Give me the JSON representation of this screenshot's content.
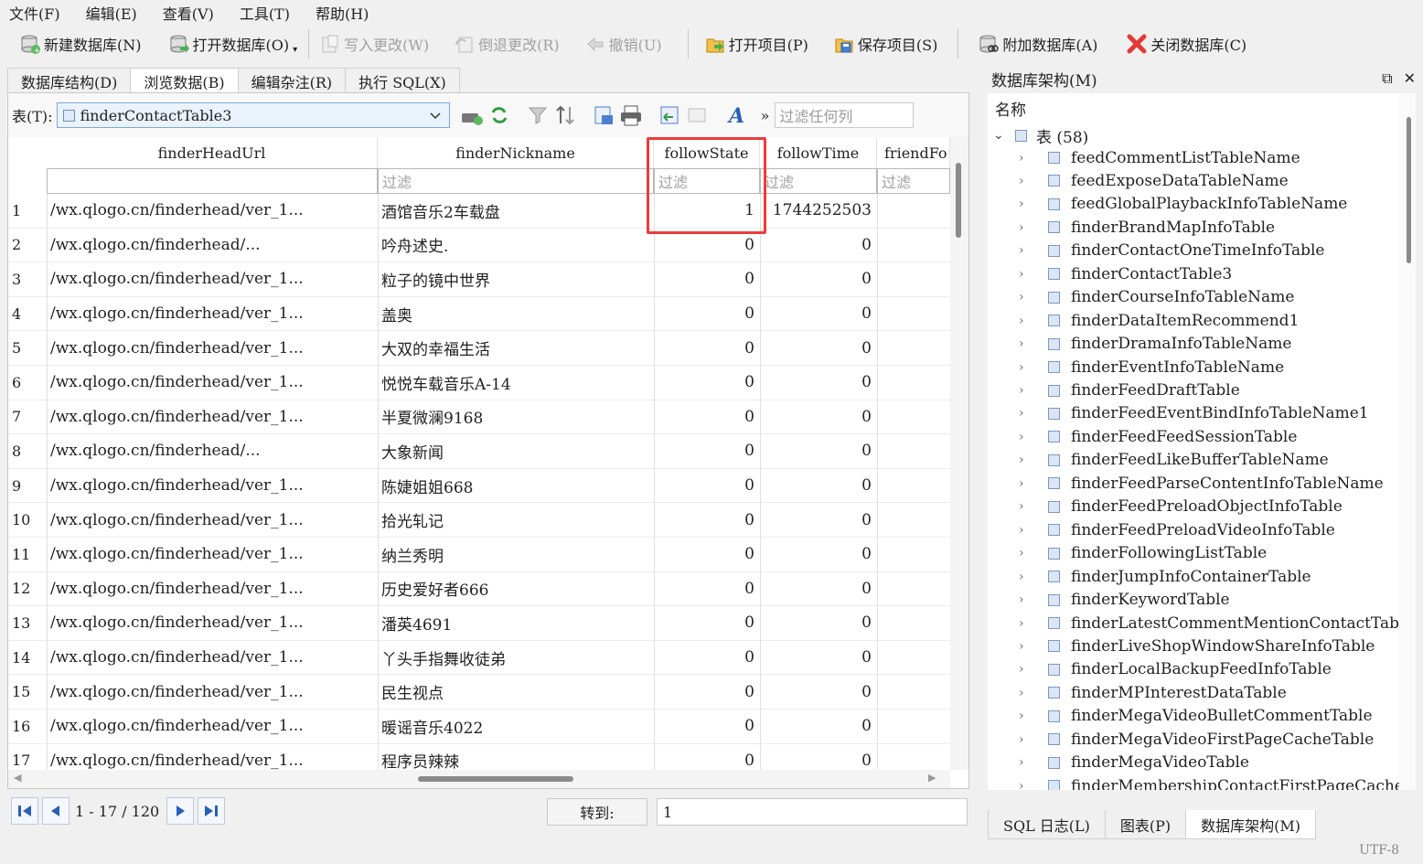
{
  "menu": [
    "文件(F)",
    "编辑(E)",
    "查看(V)",
    "工具(T)",
    "帮助(H)"
  ],
  "toolbar": {
    "new_db": "新建数据库(N)",
    "open_db": "打开数据库(O)",
    "write_changes": "写入更改(W)",
    "revert_changes": "倒退更改(R)",
    "undo": "撤销(U)",
    "open_project": "打开项目(P)",
    "save_project": "保存项目(S)",
    "attach_db": "附加数据库(A)",
    "close_db": "关闭数据库(C)"
  },
  "tabs": [
    "数据库结构(D)",
    "浏览数据(B)",
    "编辑杂注(R)",
    "执行 SQL(X)"
  ],
  "table_bar": {
    "label": "表(T):",
    "selected_table": "finderContactTable3",
    "filter_placeholder": "过滤任何列"
  },
  "grid": {
    "columns": [
      "finderHeadUrl",
      "finderNickname",
      "followState",
      "followTime",
      "friendFo"
    ],
    "filter_placeholder": "过滤",
    "rows": [
      {
        "n": "1",
        "url": "/wx.qlogo.cn/finderhead/ver_1...",
        "nick": "酒馆音乐2车载盘",
        "state": "1",
        "time": "1744252503"
      },
      {
        "n": "2",
        "url": "/wx.qlogo.cn/finderhead/...",
        "nick": "吟舟述史.",
        "state": "0",
        "time": "0"
      },
      {
        "n": "3",
        "url": "/wx.qlogo.cn/finderhead/ver_1...",
        "nick": "粒子的镜中世界",
        "state": "0",
        "time": "0"
      },
      {
        "n": "4",
        "url": "/wx.qlogo.cn/finderhead/ver_1...",
        "nick": "盖奥",
        "state": "0",
        "time": "0"
      },
      {
        "n": "5",
        "url": "/wx.qlogo.cn/finderhead/ver_1...",
        "nick": "大双的幸福生活",
        "state": "0",
        "time": "0"
      },
      {
        "n": "6",
        "url": "/wx.qlogo.cn/finderhead/ver_1...",
        "nick": "悦悦车载音乐A-14",
        "state": "0",
        "time": "0"
      },
      {
        "n": "7",
        "url": "/wx.qlogo.cn/finderhead/ver_1...",
        "nick": "半夏微澜9168",
        "state": "0",
        "time": "0"
      },
      {
        "n": "8",
        "url": "/wx.qlogo.cn/finderhead/...",
        "nick": "大象新闻",
        "state": "0",
        "time": "0"
      },
      {
        "n": "9",
        "url": "/wx.qlogo.cn/finderhead/ver_1...",
        "nick": "陈婕姐姐668",
        "state": "0",
        "time": "0"
      },
      {
        "n": "10",
        "url": "/wx.qlogo.cn/finderhead/ver_1...",
        "nick": "拾光轧记",
        "state": "0",
        "time": "0"
      },
      {
        "n": "11",
        "url": "/wx.qlogo.cn/finderhead/ver_1...",
        "nick": "纳兰秀明",
        "state": "0",
        "time": "0"
      },
      {
        "n": "12",
        "url": "/wx.qlogo.cn/finderhead/ver_1...",
        "nick": "历史爱好者666",
        "state": "0",
        "time": "0"
      },
      {
        "n": "13",
        "url": "/wx.qlogo.cn/finderhead/ver_1...",
        "nick": "潘英4691",
        "state": "0",
        "time": "0"
      },
      {
        "n": "14",
        "url": "/wx.qlogo.cn/finderhead/ver_1...",
        "nick": "丫头手指舞收徒弟",
        "state": "0",
        "time": "0"
      },
      {
        "n": "15",
        "url": "/wx.qlogo.cn/finderhead/ver_1...",
        "nick": "民生视点",
        "state": "0",
        "time": "0"
      },
      {
        "n": "16",
        "url": "/wx.qlogo.cn/finderhead/ver_1...",
        "nick": "暖谣音乐4022",
        "state": "0",
        "time": "0"
      },
      {
        "n": "17",
        "url": "/wx.qlogo.cn/finderhead/ver_1...",
        "nick": "程序员辣辣",
        "state": "0",
        "time": "0"
      }
    ]
  },
  "nav": {
    "page_info": "1 - 17 / 120",
    "goto_label": "转到:",
    "goto_value": "1"
  },
  "schema_panel": {
    "title": "数据库架构(M)",
    "column_header": "名称",
    "tables_node": "表 (58)",
    "items": [
      "feedCommentListTableName",
      "feedExposeDataTableName",
      "feedGlobalPlaybackInfoTableName",
      "finderBrandMapInfoTable",
      "finderContactOneTimeInfoTable",
      "finderContactTable3",
      "finderCourseInfoTableName",
      "finderDataItemRecommend1",
      "finderDramaInfoTableName",
      "finderEventInfoTableName",
      "finderFeedDraftTable",
      "finderFeedEventBindInfoTableName1",
      "finderFeedFeedSessionTable",
      "finderFeedLikeBufferTableName",
      "finderFeedParseContentInfoTableName",
      "finderFeedPreloadObjectInfoTable",
      "finderFeedPreloadVideoInfoTable",
      "finderFollowingListTable",
      "finderJumpInfoContainerTable",
      "finderKeywordTable",
      "finderLatestCommentMentionContactTabl",
      "finderLiveShopWindowShareInfoTable",
      "finderLocalBackupFeedInfoTable",
      "finderMPInterestDataTable",
      "finderMegaVideoBulletCommentTable",
      "finderMegaVideoFirstPageCacheTable",
      "finderMegaVideoTable",
      "finderMembershipContactFirstPageCache"
    ],
    "bottom_tabs": [
      "SQL 日志(L)",
      "图表(P)",
      "数据库架构(M)"
    ]
  },
  "status": {
    "encoding": "UTF-8"
  },
  "colors": {
    "highlight": "#ee3b3b",
    "accent": "#2a5fb8"
  }
}
